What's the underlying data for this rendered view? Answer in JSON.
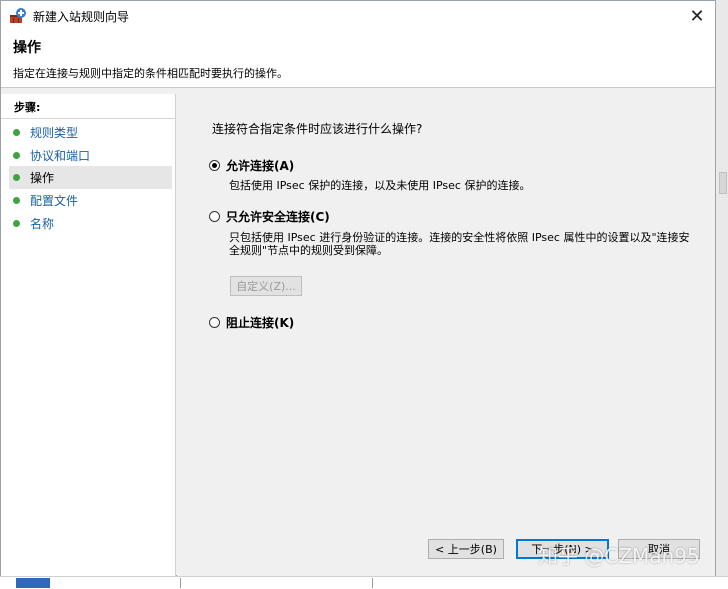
{
  "window": {
    "title": "新建入站规则向导",
    "close_symbol": "✕"
  },
  "header": {
    "title": "操作",
    "description": "指定在连接与规则中指定的条件相匹配时要执行的操作。"
  },
  "steps": {
    "title": "步骤:",
    "items": [
      {
        "label": "规则类型",
        "active": false
      },
      {
        "label": "协议和端口",
        "active": false
      },
      {
        "label": "操作",
        "active": true
      },
      {
        "label": "配置文件",
        "active": false
      },
      {
        "label": "名称",
        "active": false
      }
    ]
  },
  "main": {
    "question": "连接符合指定条件时应该进行什么操作?",
    "options": [
      {
        "label": "允许连接(A)",
        "checked": true,
        "description": "包括使用 IPsec 保护的连接，以及未使用 IPsec 保护的连接。"
      },
      {
        "label": "只允许安全连接(C)",
        "checked": false,
        "description": "只包括使用 IPsec 进行身份验证的连接。连接的安全性将依照 IPsec 属性中的设置以及\"连接安全规则\"节点中的规则受到保障。"
      },
      {
        "label": "阻止连接(K)",
        "checked": false,
        "description": ""
      }
    ],
    "customize_label": "自定义(Z)..."
  },
  "footer": {
    "back_label": "< 上一步(B)",
    "next_label": "下一步(N) >",
    "cancel_label": "取消"
  },
  "watermark": "知乎 @CZMan95",
  "colors": {
    "step_link": "#1a5fa3",
    "step_dot": "#3fa33f",
    "default_button_border": "#0078d7"
  }
}
